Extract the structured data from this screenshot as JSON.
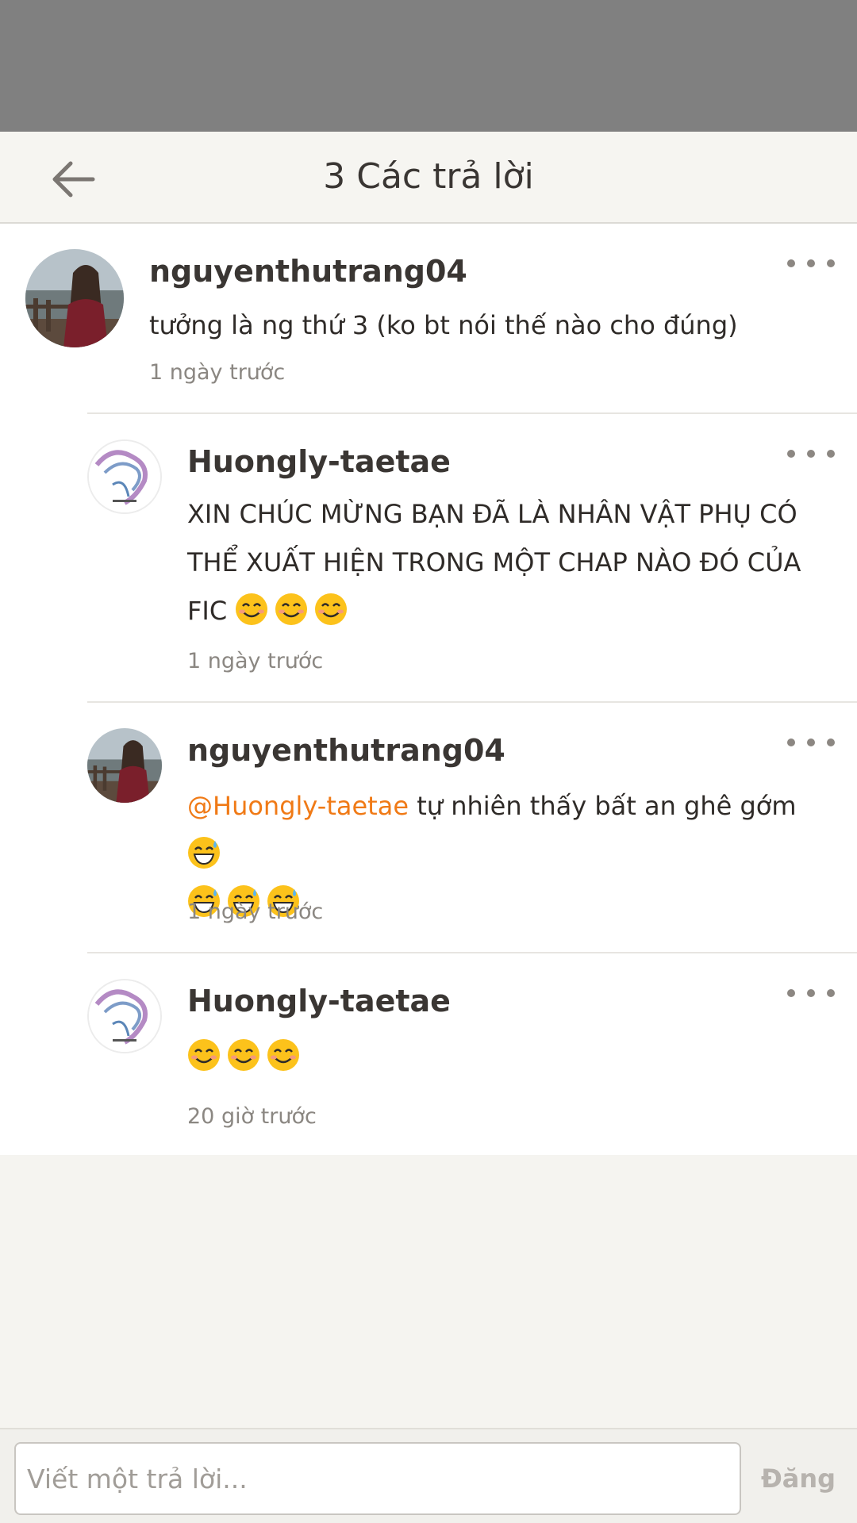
{
  "header": {
    "title": "3 Các trả lời"
  },
  "comments": [
    {
      "username": "nguyenthutrang04",
      "avatar": "girl-photo-avatar",
      "text": "tưởng là ng thứ 3 (ko bt nói thế nào cho đúng)",
      "timestamp": "1 ngày trước"
    },
    {
      "username": "Huongly-taetae",
      "avatar": "smoke-art-avatar",
      "text": "XIN CHÚC MỪNG BẠN ĐÃ LÀ NHÂN VẬT PHỤ CÓ THỂ XUẤT HIỆN TRONG MỘT CHAP NÀO ĐÓ CỦA FIC",
      "emojis": [
        "smiling-face-icon",
        "smiling-face-icon",
        "smiling-face-icon"
      ],
      "timestamp": "1 ngày trước"
    },
    {
      "username": "nguyenthutrang04",
      "avatar": "girl-photo-avatar",
      "mention": "@Huongly-taetae",
      "text": " tự nhiên thấy bất an ghê gớm",
      "emojis": [
        "sweat-smile-icon",
        "sweat-smile-icon",
        "sweat-smile-icon",
        "sweat-smile-icon"
      ],
      "timestamp": "1 ngày trước"
    },
    {
      "username": "Huongly-taetae",
      "avatar": "smoke-art-avatar",
      "emojis": [
        "smiling-face-icon",
        "smiling-face-icon",
        "smiling-face-icon"
      ],
      "timestamp": "20 giờ trước"
    }
  ],
  "composer": {
    "placeholder": "Viết một trả lời...",
    "value": "",
    "post_label": "Đăng"
  },
  "colors": {
    "mention": "#f07a16",
    "overlay": "#808080"
  }
}
